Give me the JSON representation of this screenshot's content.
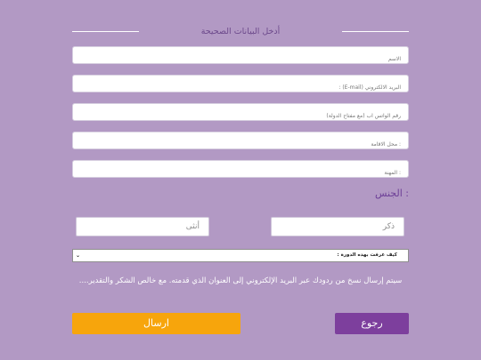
{
  "header": {
    "title": "أدخل البيانات الصحيحة"
  },
  "fields": [
    {
      "placeholder": "الاسم"
    },
    {
      "placeholder": "البريد الالكتروني (E-mail) :"
    },
    {
      "placeholder": "رقم الواتس اب (مع مفتاح الدولة)"
    },
    {
      "placeholder": ": محل الاقامة"
    },
    {
      "placeholder": ": المهنة"
    }
  ],
  "gender": {
    "label": ": الجنس",
    "male_placeholder": "ذكر",
    "female_placeholder": "أنثى"
  },
  "how_heard": {
    "selected": "كيف عرفت بهذه الدورة :"
  },
  "note": "سيتم إرسال نسخ من ردودك عبر البريد الإلكتروني إلى العنوان الذي قدمته. مع خالص الشكر والتقدير....",
  "buttons": {
    "back": "رجوع",
    "send": "ارسال"
  },
  "colors": {
    "background": "#b299c4",
    "back_button": "#7d3f9d",
    "send_button": "#f7a50c",
    "accent_text": "#6d3f97"
  }
}
